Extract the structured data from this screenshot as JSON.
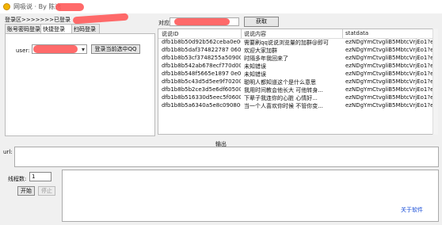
{
  "window": {
    "title": "网吸说 · By 陈逸"
  },
  "login": {
    "label": "登录区>>>>>>>已登录",
    "tabs": [
      {
        "label": "账号密码登录",
        "active": false
      },
      {
        "label": "快捷登录",
        "active": true
      },
      {
        "label": "扫码登录",
        "active": false
      }
    ],
    "user_label": "user:",
    "user_value": "",
    "login_button": "登录当前选中QQ"
  },
  "comment": {
    "label": "对应QQ:",
    "value": "",
    "fetch_button": "获取"
  },
  "table": {
    "columns": [
      "说说ID",
      "说说内容",
      "statdata"
    ],
    "rows": [
      {
        "id": "dfb1b8b50d92b562ceba0e00",
        "content": "需要刷qq说说浏览量的加群@即可",
        "stat": "ezNDgYmCtvgliB5MbtcVrjEo1?eVIN"
      },
      {
        "id": "dfb1b8b5daf374822787 0600",
        "content": "欢迎大家加群",
        "stat": "ezNDgYmCtvgliB5MbtcVrjEo1?eVIN"
      },
      {
        "id": "dfb1b8b53cf3748255a50900",
        "content": "时隔多年我回来了",
        "stat": "ezNDgYmCtvgliB5MbtcVrjEo1?eVIN"
      },
      {
        "id": "dfb1b8b542ab678ecf770d00",
        "content": "未知错误",
        "stat": "ezNDgYmCtvgliB5MbtcVrjEo1?eVIN"
      },
      {
        "id": "dfb1b8b548f5665e1897 0e00",
        "content": "未知错误",
        "stat": "ezNDgYmCtvgliB5MbtcVrjEo1?eVIN"
      },
      {
        "id": "dfb1b8b5c43d5d5ee9f70200",
        "content": "聪明人都知道这个是什么意思",
        "stat": "ezNDgYmCtvgliB5MbtcVrjEo1?eVIN"
      },
      {
        "id": "dfb1b8b5b2ce3d5e6df60500",
        "content": "我用时间教会他长大  可他转身...",
        "stat": "ezNDgYmCtvgliB5MbtcVrjEo1?eVIN"
      },
      {
        "id": "dfb1b8b516330d5eec5f0600",
        "content": "下辈子我连你的心脏  心情好...",
        "stat": "ezNDgYmCtvgliB5MbtcVrjEo1?eVIN"
      },
      {
        "id": "dfb1b8b5a6340a5e8c090800",
        "content": "当一个人喜欢你时候  不管你变...",
        "stat": "ezNDgYmCtvgliB5MbtcVrjEo1?eVIN"
      }
    ]
  },
  "output": {
    "label": "输出",
    "url_label": "url:",
    "url_value": "",
    "thread_label": "线程数:",
    "thread_value": "1",
    "start_button": "开始",
    "stop_button": "停止",
    "about_link": "关于软件"
  }
}
